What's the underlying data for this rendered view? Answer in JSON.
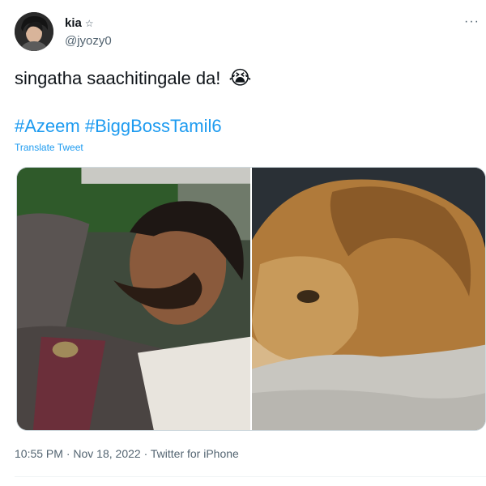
{
  "author": {
    "display_name": "kia",
    "badge_icon": "star-icon",
    "handle": "@jyozy0",
    "avatar_icon": "profile-avatar"
  },
  "more_icon": "more-options-icon",
  "tweet": {
    "text": "singatha saachitingale da!",
    "emoji": "😭",
    "hashtags": [
      "#Azeem",
      "#BiggBossTamil6"
    ],
    "translate_label": "Translate Tweet"
  },
  "media": [
    {
      "icon": "man-lying-down-photo"
    },
    {
      "icon": "lion-resting-photo"
    }
  ],
  "meta": {
    "time": "10:55 PM",
    "date": "Nov 18, 2022",
    "separator": "·",
    "source": "Twitter for iPhone"
  },
  "colors": {
    "link": "#1d9bf0",
    "text": "#0f1419",
    "secondary": "#536471",
    "border": "#cfd9de"
  }
}
